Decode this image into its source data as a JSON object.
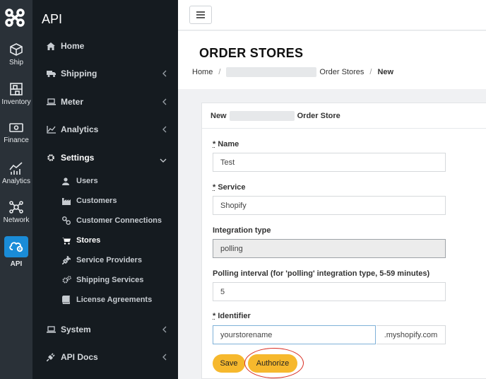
{
  "rail": {
    "items": [
      {
        "label": "Ship",
        "icon": "box-icon"
      },
      {
        "label": "Inventory",
        "icon": "shelves-icon"
      },
      {
        "label": "Finance",
        "icon": "money-icon"
      },
      {
        "label": "Analytics",
        "icon": "chart-icon"
      },
      {
        "label": "Network",
        "icon": "network-icon"
      },
      {
        "label": "API",
        "icon": "cloud-gear-icon"
      }
    ],
    "active_color": "#1a8cd8"
  },
  "sidebar": {
    "title": "API",
    "nav": [
      {
        "label": "Home",
        "icon": "home-icon"
      },
      {
        "label": "Shipping",
        "icon": "truck-icon"
      },
      {
        "label": "Meter",
        "icon": "laptop-icon"
      },
      {
        "label": "Analytics",
        "icon": "area-chart-icon"
      },
      {
        "label": "Settings",
        "icon": "gear-icon"
      }
    ],
    "settings_items": [
      {
        "label": "Users",
        "icon": "user-icon"
      },
      {
        "label": "Customers",
        "icon": "industry-icon"
      },
      {
        "label": "Customer Connections",
        "icon": "link-icon"
      },
      {
        "label": "Stores",
        "icon": "cart-icon"
      },
      {
        "label": "Service Providers",
        "icon": "plug-icon"
      },
      {
        "label": "Shipping Services",
        "icon": "cogs-icon"
      },
      {
        "label": "License Agreements",
        "icon": "book-icon"
      }
    ],
    "nav_bottom": [
      {
        "label": "System",
        "icon": "laptop-icon"
      },
      {
        "label": "API Docs",
        "icon": "plug-icon"
      }
    ]
  },
  "page": {
    "title": "ORDER STORES",
    "breadcrumb": {
      "home": "Home",
      "stores": "Order Stores",
      "current": "New"
    }
  },
  "form": {
    "card_title_prefix": "New",
    "card_title_suffix": "Order Store",
    "name": {
      "required": "*",
      "label": "Name",
      "value": "Test"
    },
    "service": {
      "required": "*",
      "label": "Service",
      "value": "Shopify"
    },
    "integration_type": {
      "label": "Integration type",
      "value": "polling"
    },
    "polling_interval": {
      "label": "Polling interval (for 'polling' integration type, 5-59 minutes)",
      "value": "5"
    },
    "identifier": {
      "required": "*",
      "label": "Identifier",
      "value": "yourstorename",
      "suffix": ".myshopify.com"
    },
    "save_label": "Save",
    "authorize_label": "Authorize"
  }
}
